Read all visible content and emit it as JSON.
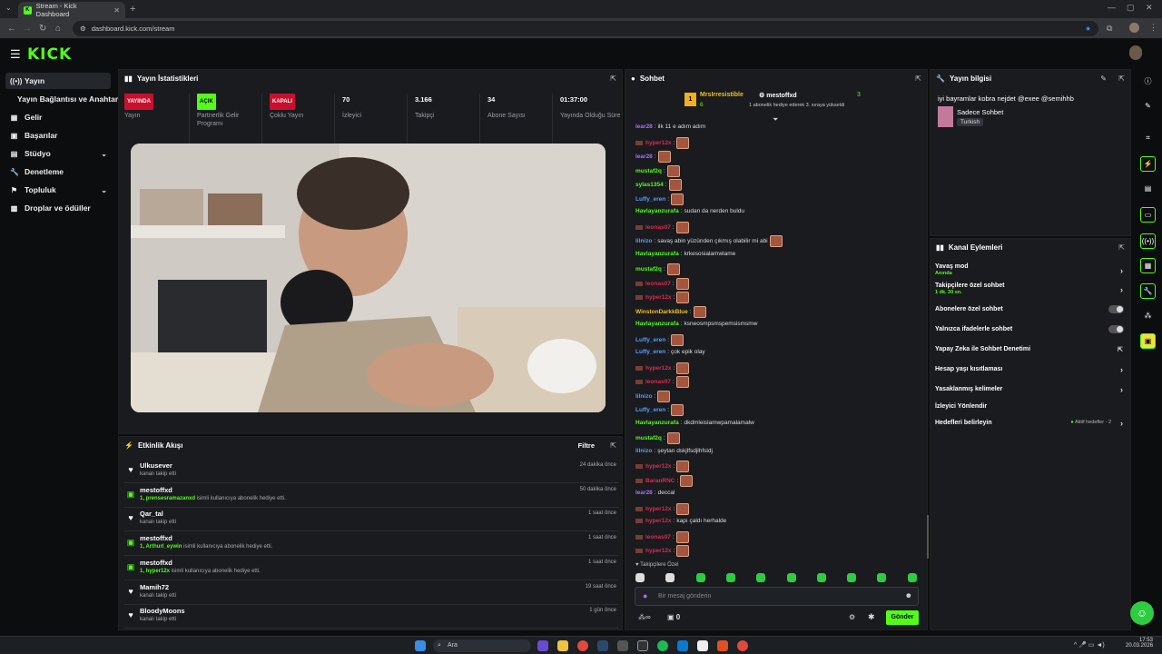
{
  "browser": {
    "tab_title": "Stream - Kick Dashboard",
    "url": "dashboard.kick.com/stream"
  },
  "header": {
    "logo": "KICK"
  },
  "sidebar": {
    "items": [
      {
        "label": "Yayın",
        "icon": "radio-icon"
      },
      {
        "label": "Yayın Bağlantısı ve Anahtarı",
        "icon": "key-icon"
      },
      {
        "label": "Gelir",
        "icon": "chart-icon"
      },
      {
        "label": "Başarılar",
        "icon": "trophy-icon"
      },
      {
        "label": "Stüdyo",
        "icon": "studio-icon"
      },
      {
        "label": "Denetleme",
        "icon": "wrench-icon"
      },
      {
        "label": "Topluluk",
        "icon": "community-icon"
      },
      {
        "label": "Droplar ve ödüller",
        "icon": "gift-icon"
      }
    ]
  },
  "stats": {
    "title": "Yayın İstatistikleri",
    "items": [
      {
        "value": "YAYINDA",
        "label": "Yayın",
        "badge": "#c8102e"
      },
      {
        "value": "AÇIK",
        "label": "Partnerlik Gelir Programı",
        "badge": "#53fc18"
      },
      {
        "value": "KAPALI",
        "label": "Çoklu Yayın",
        "badge": "#c8102e"
      },
      {
        "value": "70",
        "label": "İzleyici"
      },
      {
        "value": "3.166",
        "label": "Takipçi"
      },
      {
        "value": "34",
        "label": "Abone Sayısı"
      },
      {
        "value": "01:37:00",
        "label": "Yayında Olduğu Süre"
      }
    ]
  },
  "activity": {
    "title": "Etkinlik Akışı",
    "filter": "Filtre",
    "items": [
      {
        "name": "Ulkusever",
        "desc": "kanalı takip etti",
        "bold": "",
        "time": "24 dakika önce",
        "icon": "heart-icon"
      },
      {
        "name": "mestoffxd",
        "bold": "1, prensesramazanxd",
        "desc": "isimli kullanıcıya abonelik hediye etti.",
        "time": "50 dakika önce",
        "icon": "gift-icon"
      },
      {
        "name": "Qar_tal",
        "desc": "kanalı takip etti",
        "bold": "",
        "time": "1 saat önce",
        "icon": "heart-icon"
      },
      {
        "name": "mestoffxd",
        "bold": "1, Arthurl_eywin",
        "desc": "isimli kullanıcıya abonelik hediye etti.",
        "time": "1 saat önce",
        "icon": "gift-icon"
      },
      {
        "name": "mestoffxd",
        "bold": "1, hyper12x",
        "desc": "isimli kullanıcıya abonelik hediye etti.",
        "time": "1 saat önce",
        "icon": "gift-icon"
      },
      {
        "name": "Mamih72",
        "desc": "kanalı takip etti",
        "bold": "",
        "time": "19 saat önce",
        "icon": "heart-icon"
      },
      {
        "name": "BloodyMoons",
        "desc": "kanalı takip etti",
        "bold": "",
        "time": "1 gün önce",
        "icon": "heart-icon"
      }
    ]
  },
  "chat": {
    "title": "Sohbet",
    "gifter": {
      "name": "MrsIrresistible",
      "count": "6",
      "recipient": "mestoffxd",
      "rank": "3",
      "note": "1 abonelik hediye ederek 3. sıraya yükseldi"
    },
    "messages": [
      {
        "user": "lear28",
        "color": "#a970ff",
        "text": "ilk 11 e adım adım",
        "emote": false
      },
      {
        "user": "hyper12x",
        "color": "#e0284f",
        "text": "",
        "emote": true
      },
      {
        "user": "lear28",
        "color": "#a970ff",
        "text": "",
        "emote": true
      },
      {
        "user": "mustaf2q",
        "color": "#53fc18",
        "text": "",
        "emote": true
      },
      {
        "user": "sylas1354",
        "color": "#53fc18",
        "text": "",
        "emote": true
      },
      {
        "user": "Luffy_eren",
        "color": "#5a9cff",
        "text": "",
        "emote": true
      },
      {
        "user": "Havlayanzurafa",
        "color": "#53fc18",
        "text": "sudan da nerden buldu",
        "emote": false
      },
      {
        "user": "leonas07",
        "color": "#e0284f",
        "text": "",
        "emote": true
      },
      {
        "user": "lilnizo",
        "color": "#5a9cff",
        "text": "savaş abin yüzünden çıkmış olabilir mi abi",
        "emote": true
      },
      {
        "user": "Havlayanzurafa",
        "color": "#53fc18",
        "text": "krkesosialamwlame",
        "emote": false
      },
      {
        "user": "mustaf2q",
        "color": "#53fc18",
        "text": "",
        "emote": true
      },
      {
        "user": "leonas07",
        "color": "#e0284f",
        "text": "",
        "emote": true
      },
      {
        "user": "hyper12x",
        "color": "#e0284f",
        "text": "",
        "emote": true
      },
      {
        "user": "WinstonDarkkBlue",
        "color": "#f0c020",
        "text": "",
        "emote": true
      },
      {
        "user": "Havlayanzurafa",
        "color": "#53fc18",
        "text": "ksneosmpsmspemsismsmw",
        "emote": false
      },
      {
        "user": "Luffy_eren",
        "color": "#5a9cff",
        "text": "",
        "emote": true
      },
      {
        "user": "Luffy_eren",
        "color": "#5a9cff",
        "text": "çok epik olay",
        "emote": false
      },
      {
        "user": "hyper12x",
        "color": "#e0284f",
        "text": "",
        "emote": true
      },
      {
        "user": "leonas07",
        "color": "#e0284f",
        "text": "",
        "emote": true
      },
      {
        "user": "lilnizo",
        "color": "#5a9cff",
        "text": "",
        "emote": true
      },
      {
        "user": "Luffy_eren",
        "color": "#5a9cff",
        "text": "",
        "emote": true
      },
      {
        "user": "Havlayanzurafa",
        "color": "#53fc18",
        "text": "dkdmleislamwpamalamalw",
        "emote": false
      },
      {
        "user": "mustaf2q",
        "color": "#53fc18",
        "text": "",
        "emote": true
      },
      {
        "user": "lilnizo",
        "color": "#5a9cff",
        "text": "şeytan dskjlfsdjlhfsldj",
        "emote": false
      },
      {
        "user": "hyper12x",
        "color": "#e0284f",
        "text": "",
        "emote": true
      },
      {
        "user": "BaranRNC",
        "color": "#e0284f",
        "text": "",
        "emote": true
      },
      {
        "user": "lear28",
        "color": "#a970ff",
        "text": "deccal",
        "emote": false
      },
      {
        "user": "hyper12x",
        "color": "#e0284f",
        "text": "",
        "emote": true
      },
      {
        "user": "hyper12x",
        "color": "#e0284f",
        "text": "kapı çaldı herhalde",
        "emote": false
      },
      {
        "user": "leonas07",
        "color": "#e0284f",
        "text": "",
        "emote": true
      },
      {
        "user": "hyper12x",
        "color": "#e0284f",
        "text": "",
        "emote": true
      }
    ],
    "followers_only": "Takipçilere Özel",
    "input_placeholder": "Bir mesaj gönderin",
    "infinity": "∞",
    "count": "0",
    "send": "Gönder"
  },
  "info": {
    "title": "Yayın bilgisi",
    "stream_title": "iyi bayramlar kobra nejdet @exee @semihhb",
    "category": "Sadece Sohbet",
    "language": "Turkish"
  },
  "actions": {
    "title": "Kanal Eylemleri",
    "rows": [
      {
        "label": "Yavaş mod",
        "sub": "Anında",
        "control": "chevron"
      },
      {
        "label": "Takipçilere özel sohbet",
        "sub": "1 dk. 30 sn.",
        "control": "chevron"
      },
      {
        "label": "Abonelere özel sohbet",
        "sub": "",
        "control": "toggle"
      },
      {
        "label": "Yalnızca ifadelerle sohbet",
        "sub": "",
        "control": "toggle"
      },
      {
        "label": "Yapay Zeka ile Sohbet Denetimi",
        "sub": "",
        "control": "external"
      },
      {
        "label": "Hesap yaşı kısıtlaması",
        "sub": "",
        "control": "chevron"
      },
      {
        "label": "Yasaklanmış kelimeler",
        "sub": "",
        "control": "chevron"
      },
      {
        "label": "İzleyici Yönlendir",
        "sub": "",
        "control": "none"
      },
      {
        "label": "Hedefleri belirleyin",
        "sub": "",
        "control": "chevron",
        "extra": "Aktif hedefler - 2"
      }
    ]
  },
  "taskbar": {
    "search": "Ara",
    "time": "17:53",
    "date": "20.03.2026"
  }
}
